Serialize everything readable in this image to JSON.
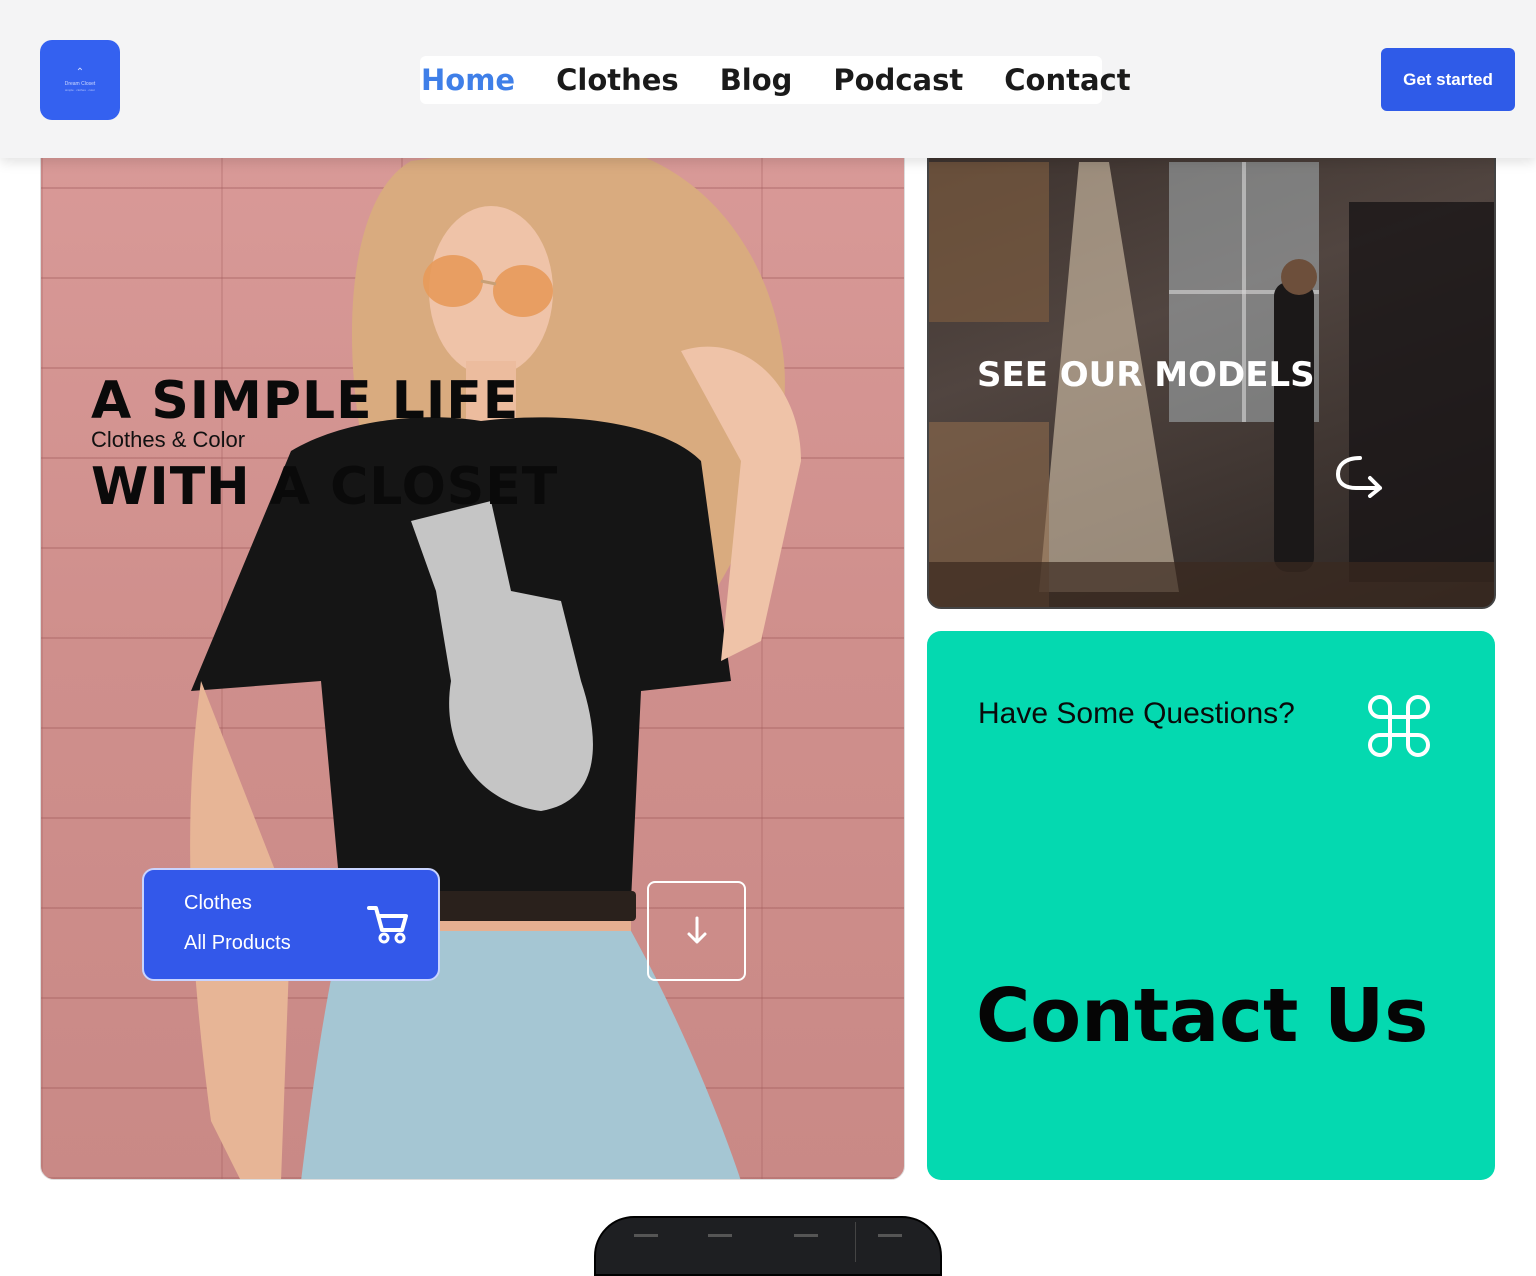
{
  "header": {
    "logo": {
      "mark": "⌃",
      "text": "Dream Closet",
      "sub": "simple · clothes · color"
    },
    "nav": [
      "Home",
      "Clothes",
      "Blog",
      "Podcast",
      "Contact"
    ],
    "cta_label": "Get started"
  },
  "hero": {
    "title_line1": "A SIMPLE LIFE",
    "subtitle": "Clothes & Color",
    "title_line2": "WITH A CLOSET",
    "products_button": {
      "line1": "Clothes",
      "line2": "All Products"
    },
    "scroll_icon": "arrow-down-icon"
  },
  "models": {
    "title": "SEE OUR MODELS",
    "icon": "arrow-return-icon"
  },
  "contact": {
    "question": "Have Some Questions?",
    "title": "Contact Us",
    "icon": "command-icon"
  },
  "colors": {
    "brand": "#3358ea",
    "nav_active": "#3f7fe8",
    "contact_bg": "#04d9b0"
  }
}
